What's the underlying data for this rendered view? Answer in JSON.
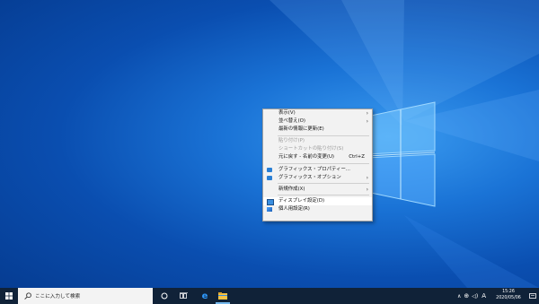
{
  "context_menu": {
    "items": [
      {
        "label": "表示(V)",
        "submenu": true,
        "disabled": false
      },
      {
        "label": "並べ替え(O)",
        "submenu": true,
        "disabled": false
      },
      {
        "label": "最新の情報に更新(E)",
        "submenu": false,
        "disabled": false
      },
      {
        "label": "貼り付け(P)",
        "submenu": false,
        "disabled": true
      },
      {
        "label": "ショートカットの貼り付け(S)",
        "submenu": false,
        "disabled": true
      },
      {
        "label": "元に戻す - 名前の変更(U)",
        "shortcut": "Ctrl+Z",
        "submenu": false,
        "disabled": false
      },
      {
        "label": "グラフィックス・プロパティー...",
        "icon": "intel-graphics-icon",
        "submenu": false,
        "disabled": false
      },
      {
        "label": "グラフィックス・オプション",
        "icon": "intel-graphics-icon",
        "submenu": true,
        "disabled": false
      },
      {
        "label": "新規作成(X)",
        "submenu": true,
        "disabled": false
      },
      {
        "label": "ディスプレイ設定(D)",
        "icon": "display-settings-icon",
        "submenu": false,
        "disabled": false,
        "highlighted": true
      },
      {
        "label": "個人用設定(R)",
        "icon": "personalize-icon",
        "submenu": false,
        "disabled": false
      }
    ]
  },
  "taskbar": {
    "search_placeholder": "ここに入力して検索",
    "ime_indicator": "A",
    "time": "15:26",
    "date": "2020/05/06"
  },
  "colors": {
    "taskbar_bg": "#102238",
    "menu_bg": "#f2f2f2",
    "desktop_accent": "#1a73d6"
  }
}
